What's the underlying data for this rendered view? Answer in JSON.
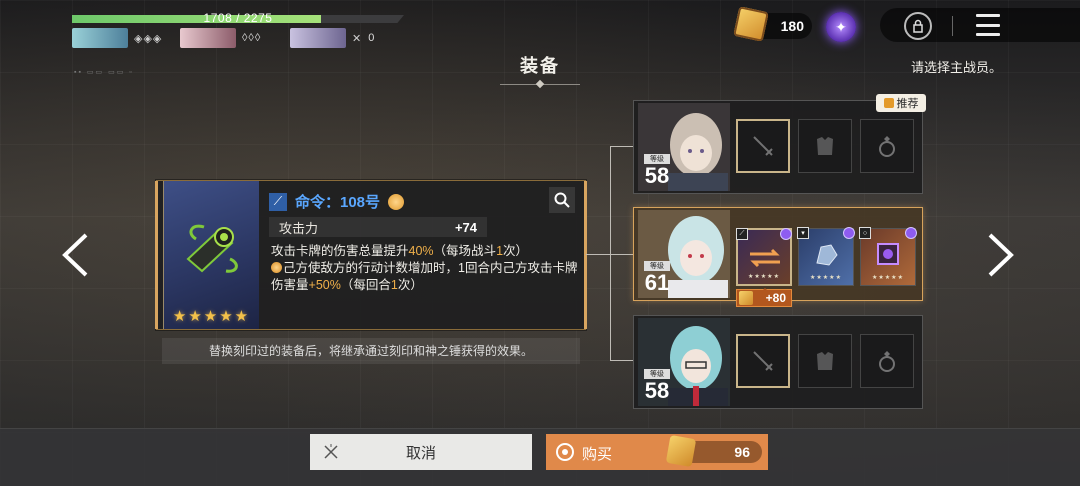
{
  "topbar": {
    "hp_text": "1708 / 2275",
    "hp_fraction": 0.751,
    "team": [
      {
        "icons": "◈◈◈",
        "count": ""
      },
      {
        "icons": "◊◊◊",
        "count": ""
      },
      {
        "icons": "✕",
        "count": "0"
      }
    ],
    "currency_value": "180"
  },
  "page": {
    "title": "装备",
    "hint": "请选择主战员。"
  },
  "item": {
    "name": "命令：108号",
    "stars": "★★★★★",
    "stat_label": "攻击力",
    "stat_value": "+74",
    "desc1_a": "攻击卡牌的伤害总量提升",
    "desc1_b": "40%",
    "desc1_c": "（每场战斗",
    "desc1_d": "1",
    "desc1_e": "次）",
    "desc2_a": "己方使敌方的行动计数增加时，1回合内己方攻击卡牌伤害量",
    "desc2_b": "+50%",
    "desc2_c": "（每回合",
    "desc2_d": "1",
    "desc2_e": "次）",
    "note": "替换刻印过的装备后，将继承通过刻印和神之锤获得的效果。"
  },
  "characters": [
    {
      "level_label": "等级",
      "level": "58",
      "recommend": "推荐"
    },
    {
      "level_label": "等级",
      "level": "61",
      "bonus": "+80"
    },
    {
      "level_label": "等级",
      "level": "58"
    }
  ],
  "buttons": {
    "cancel": "取消",
    "buy": "购买",
    "price": "96"
  },
  "colors": {
    "accent_gold": "#d7a35c",
    "buy_orange": "#e0894a",
    "item_name_blue": "#5aa7ff",
    "highlight": "#f0b04a"
  }
}
